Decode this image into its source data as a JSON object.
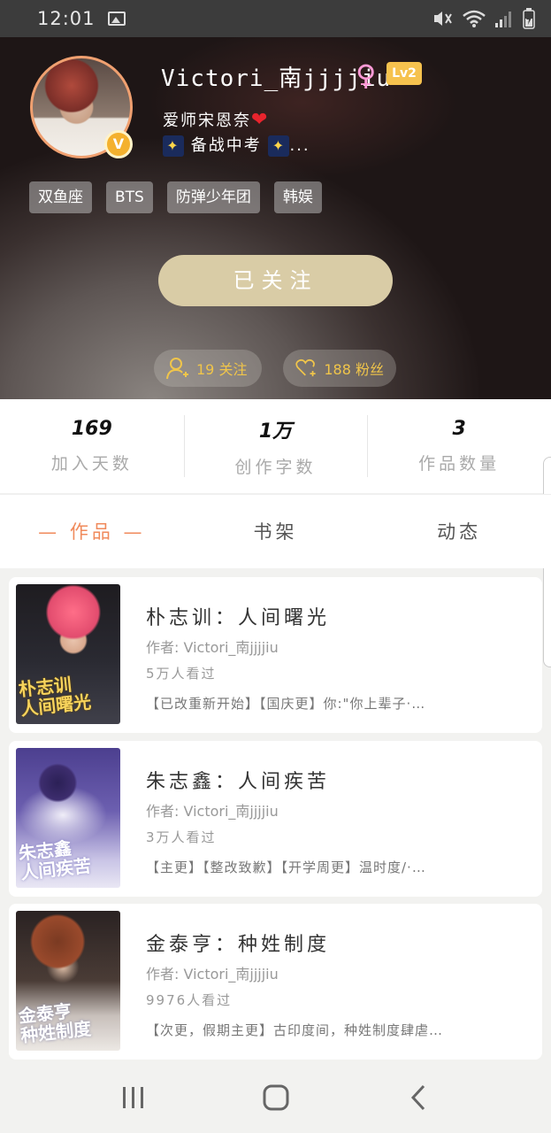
{
  "status_bar": {
    "time": "12:01",
    "icons": [
      "image-icon",
      "mute-icon",
      "wifi-icon",
      "signal-icon",
      "battery-icon"
    ]
  },
  "profile": {
    "username": "Victori_南jjjjiu",
    "gender_symbol": "♀",
    "level": "Lv2",
    "verified_badge": "V",
    "bio_line1": "爱师宋恩奈",
    "bio_heart": "❤",
    "bio_line2": "备战中考",
    "bio_ellipsis": "...",
    "tags": [
      "双鱼座",
      "BTS",
      "防弹少年团",
      "韩娱"
    ],
    "follow_button": "已关注",
    "following": "19 关注",
    "fans": "188 粉丝"
  },
  "stats": [
    {
      "value": "169",
      "label": "加入天数"
    },
    {
      "value": "1万",
      "label": "创作字数"
    },
    {
      "value": "3",
      "label": "作品数量"
    }
  ],
  "tabs": [
    {
      "label": "— 作品 —",
      "active": true
    },
    {
      "label": "书架",
      "active": false
    },
    {
      "label": "动态",
      "active": false
    }
  ],
  "works": [
    {
      "title": "朴志训：人间曙光",
      "author": "作者: Victori_南jjjjiu",
      "views": "5万人看过",
      "desc": "【已改重新开始】【国庆更】你:\"你上辈子·…",
      "cover_text": "朴志训\n人间曙光"
    },
    {
      "title": "朱志鑫：人间疾苦",
      "author": "作者: Victori_南jjjjiu",
      "views": "3万人看过",
      "desc": "【主更】【整改致歉】【开学周更】温时度/·…",
      "cover_text": "朱志鑫\n人间疾苦"
    },
    {
      "title": "金泰亨：种姓制度",
      "author": "作者: Victori_南jjjjiu",
      "views": "9976人看过",
      "desc": "【次更，假期主更】古印度间，种姓制度肆虐…",
      "cover_text": "金泰亨\n种姓制度"
    }
  ],
  "colors": {
    "accent_orange": "#f08a5b",
    "follow_button_bg": "#d9cca6",
    "level_badge": "#f6c24e",
    "stat_pill_text": "#f0c54a"
  }
}
